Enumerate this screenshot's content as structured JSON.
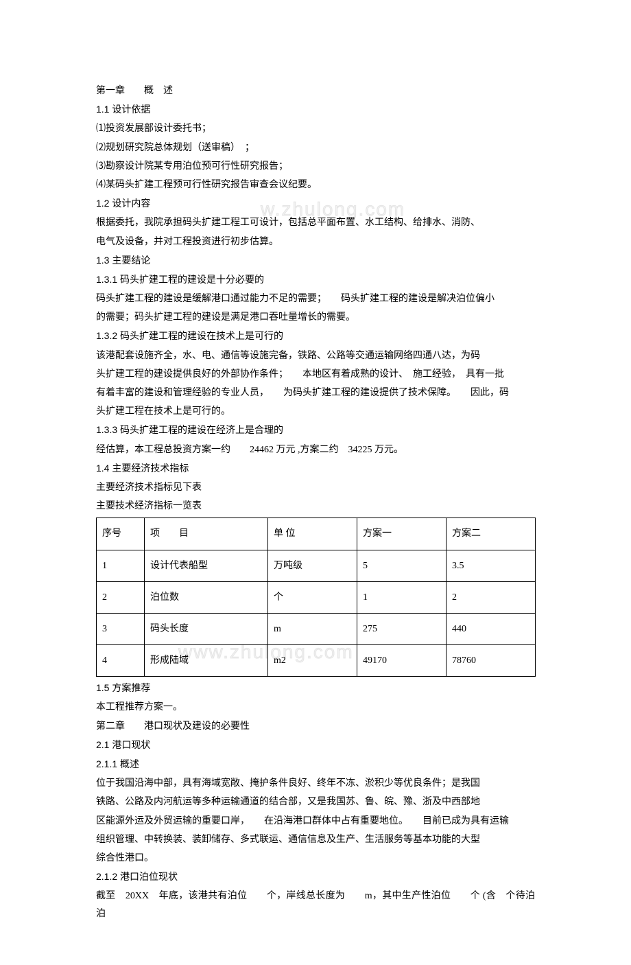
{
  "watermarks": {
    "wm1": "w.zhulong.com",
    "wm2": "www.zhulong.com"
  },
  "chapter1": {
    "title": "第一章　　概　述",
    "s1_1": {
      "heading": "1.1 设计依据",
      "items": [
        "⑴投资发展部设计委托书；",
        "⑵规划研究院总体规划（送审稿）　；",
        "⑶勘察设计院某专用泊位预可行性研究报告；",
        "⑷某码头扩建工程预可行性研究报告审查会议纪要。"
      ]
    },
    "s1_2": {
      "heading": "1.2 设计内容",
      "lines": [
        "根据委托，我院承担码头扩建工程工可设计，包括总平面布置、水工结构、给排水、消防、",
        "电气及设备，并对工程投资进行初步估算。"
      ]
    },
    "s1_3": {
      "heading": "1.3 主要结论",
      "s1_3_1": {
        "heading": "1.3.1 码头扩建工程的建设是十分必要的",
        "lines": [
          "码头扩建工程的建设是缓解港口通过能力不足的需要；　　码头扩建工程的建设是解决泊位偏小",
          "的需要；码头扩建工程的建设是满足港口吞吐量增长的需要。"
        ]
      },
      "s1_3_2": {
        "heading": "1.3.2 码头扩建工程的建设在技术上是可行的",
        "lines": [
          "该港配套设施齐全，水、电、通信等设施完备，铁路、公路等交通运输网络四通八达，为码",
          "头扩建工程的建设提供良好的外部协作条件；　　本地区有着成熟的设计、　施工经验，　具有一批",
          "有着丰富的建设和管理经验的专业人员，　　为码头扩建工程的建设提供了技术保障。　　因此，码",
          "头扩建工程在技术上是可行的。"
        ]
      },
      "s1_3_3": {
        "heading": "1.3.3 码头扩建工程的建设在经济上是合理的",
        "line": "经估算，本工程总投资方案一约　　24462 万元 ,方案二约　34225 万元。"
      }
    },
    "s1_4": {
      "heading": "1.4 主要经济技术指标",
      "lines": [
        "主要经济技术指标见下表",
        "主要技术经济指标一览表"
      ],
      "table": {
        "headers": [
          "序号",
          "项　　目",
          "单 位",
          "方案一",
          "方案二"
        ],
        "rows": [
          [
            "1",
            "设计代表船型",
            "万吨级",
            "5",
            "3.5"
          ],
          [
            "2",
            "泊位数",
            "个",
            "1",
            "2"
          ],
          [
            "3",
            "码头长度",
            "m",
            "275",
            "440"
          ],
          [
            "4",
            "形成陆域",
            "m2",
            "49170",
            "78760"
          ]
        ]
      }
    },
    "s1_5": {
      "heading": "1.5 方案推荐",
      "line": "本工程推荐方案一。"
    }
  },
  "chapter2": {
    "title": "第二章　　港口现状及建设的必要性",
    "s2_1": {
      "heading": "2.1 港口现状",
      "s2_1_1": {
        "heading": "2.1.1 概述",
        "lines": [
          "位于我国沿海中部，具有海域宽敞、掩护条件良好、终年不冻、淤积少等优良条件；是我国",
          "铁路、公路及内河航运等多种运输通道的结合部，又是我国苏、鲁、皖、豫、浙及中西部地",
          "区能源外运及外贸运输的重要口岸，　　在沿海港口群体中占有重要地位。　　目前已成为具有运输",
          "组织管理、中转换装、装卸储存、多式联运、通信信息及生产、生活服务等基本功能的大型",
          "综合性港口。"
        ]
      },
      "s2_1_2": {
        "heading": "2.1.2 港口泊位现状",
        "line": "截至　20XX　年底，该港共有泊位　　个，岸线总长度为　　m，其中生产性泊位　　个 (含　个待泊泊"
      }
    }
  }
}
